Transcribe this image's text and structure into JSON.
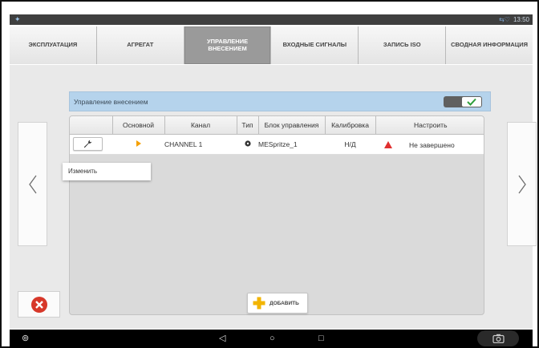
{
  "status_bar": {
    "time": "13:50"
  },
  "tabs": [
    {
      "label": "ЭКСПЛУАТАЦИЯ",
      "active": false
    },
    {
      "label": "АГРЕГАТ",
      "active": false
    },
    {
      "label": "УПРАВЛЕНИЕ ВНЕСЕНИЕМ",
      "active": true
    },
    {
      "label": "ВХОДНЫЕ СИГНАЛЫ",
      "active": false
    },
    {
      "label": "ЗАПИСЬ ISO",
      "active": false
    },
    {
      "label": "СВОДНАЯ ИНФОРМАЦИЯ",
      "active": false
    }
  ],
  "panel": {
    "title": "Управление внесением",
    "toggle_on": true
  },
  "table": {
    "headers": [
      "",
      "Основной",
      "Канал",
      "Тип",
      "Блок управления",
      "Калибровка",
      "Настроить"
    ],
    "rows": [
      {
        "channel": "CHANNEL 1",
        "controller": "MESpritze_1",
        "calibration": "Н/Д",
        "setup": "Не завершено"
      }
    ]
  },
  "context_menu": {
    "item": "Изменить"
  },
  "add_button": {
    "label": "ДОБАВИТЬ"
  },
  "colors": {
    "accent_orange": "#f5a000",
    "warning_red": "#e03030",
    "header_blue": "#b5d3ec",
    "close_red": "#d7382a"
  },
  "icons": [
    "pin-icon",
    "wifi-icon",
    "chevron-left-icon",
    "chevron-right-icon",
    "close-icon",
    "wrench-icon",
    "play-icon",
    "warning-icon",
    "plus-icon",
    "checkmark-icon",
    "back-icon",
    "home-icon",
    "recents-icon",
    "screenshot-icon"
  ]
}
